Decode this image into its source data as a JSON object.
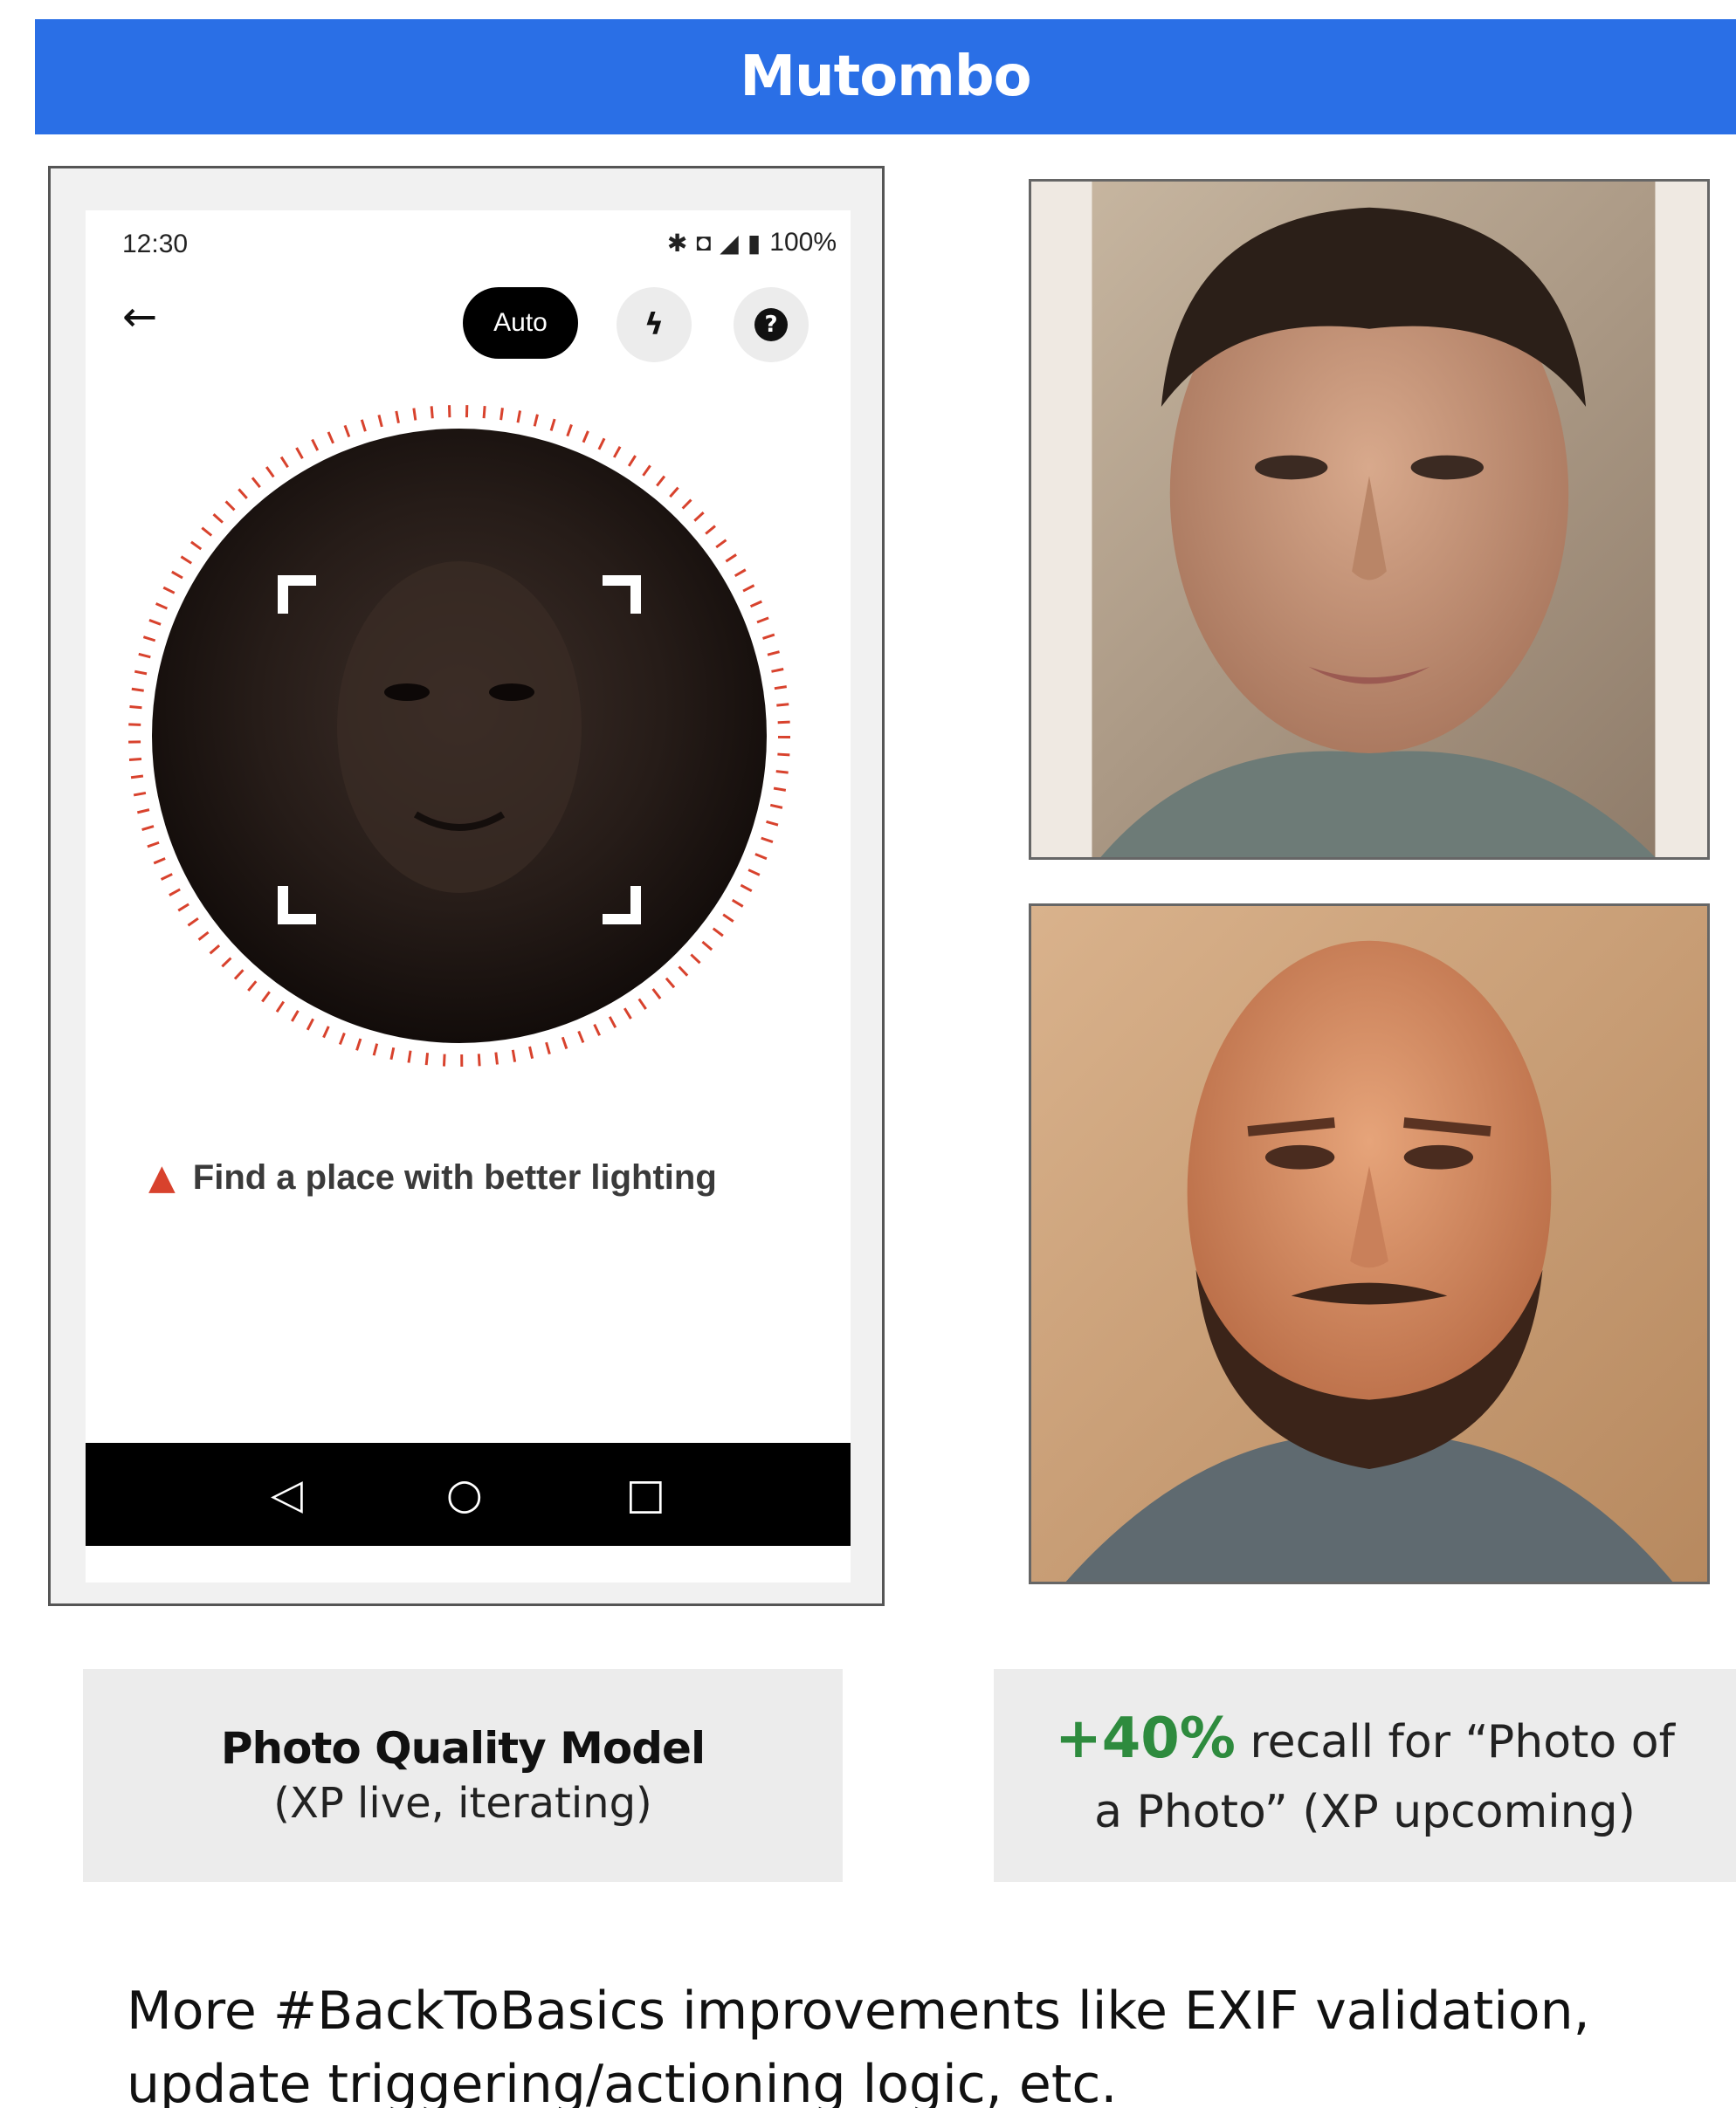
{
  "banner": {
    "title": "Mutombo"
  },
  "phone": {
    "status_time": "12:30",
    "status_battery": "100%",
    "icons": {
      "back": "arrow-left-icon",
      "flash": "flash-off-icon",
      "help": "help-icon",
      "warning": "warning-icon"
    },
    "auto_label": "Auto",
    "lighting_message": "Find a place with better lighting",
    "nav": {
      "back": "◁",
      "home": "○",
      "recents": "□"
    },
    "colors": {
      "ring": "#d8422d",
      "nav_bar": "#000000"
    }
  },
  "captions": {
    "left_title": "Photo Quality Model",
    "left_sub": "(XP live, iterating)",
    "right_pct": "+40%",
    "right_line1_rest": " recall for “Photo of",
    "right_line2": "a Photo” (XP upcoming)"
  },
  "footer": {
    "line1": "More #BackToBasics improvements like EXIF validation,",
    "line2": "update triggering/actioning logic, etc."
  },
  "colors": {
    "banner": "#2a6fe6",
    "accent_green": "#2e8b3e"
  }
}
